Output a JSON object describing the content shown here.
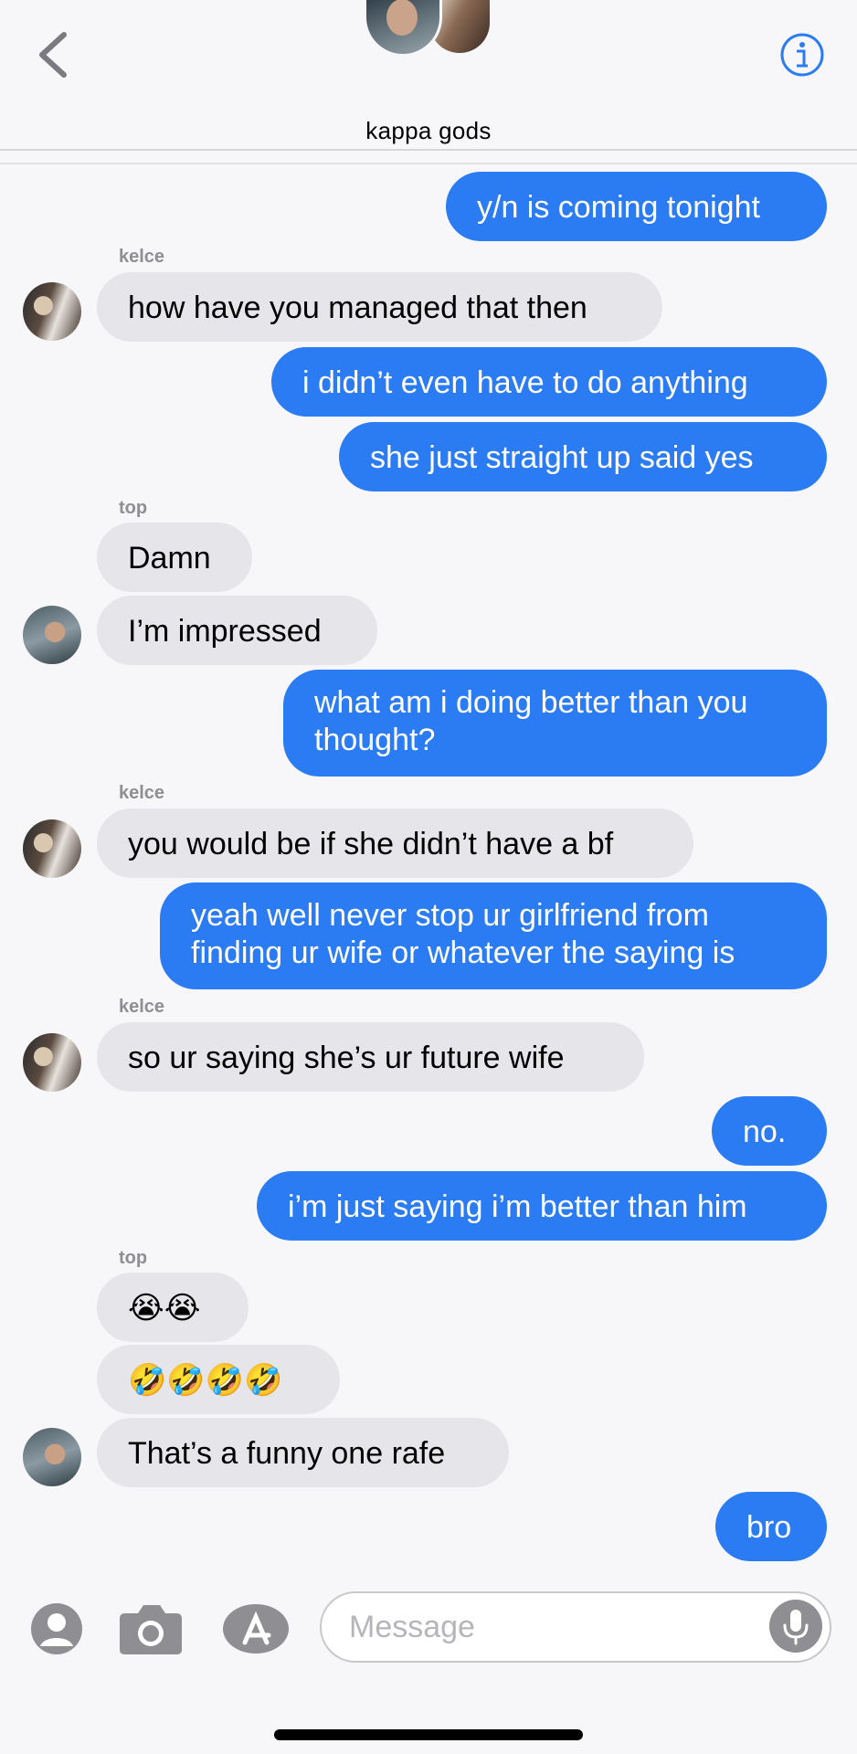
{
  "header": {
    "title": "kappa gods"
  },
  "messages": [
    {
      "text": "y/n is coming tonight"
    },
    {
      "sender": "kelce"
    },
    {
      "text": "how have you managed that then"
    },
    {
      "text": "i didn’t even have to do anything"
    },
    {
      "text": "she just straight up said yes"
    },
    {
      "sender": "top"
    },
    {
      "text": "Damn"
    },
    {
      "text": "I’m impressed"
    },
    {
      "text": "what am i doing better than you thought?"
    },
    {
      "sender": "kelce"
    },
    {
      "text": "you would be if she didn’t have a bf"
    },
    {
      "text": "yeah well never stop ur girlfriend from finding ur wife or whatever the saying is"
    },
    {
      "sender": "kelce"
    },
    {
      "text": "so ur saying she’s ur future wife"
    },
    {
      "text": "no."
    },
    {
      "text": "i’m just saying i’m better than him"
    },
    {
      "sender": "top"
    },
    {
      "text": "😭😭"
    },
    {
      "text": "🤣🤣🤣🤣"
    },
    {
      "text": "That’s a funny one rafe"
    },
    {
      "text": "bro"
    }
  ],
  "input": {
    "placeholder": "Message"
  },
  "colors": {
    "outgoing_bubble": "#2b7cf3",
    "incoming_bubble": "#e5e5ea",
    "accent": "#2b7cf3"
  },
  "icons": [
    "back-chevron-icon",
    "info-icon",
    "contact-icon",
    "camera-icon",
    "app-store-icon",
    "microphone-icon"
  ]
}
